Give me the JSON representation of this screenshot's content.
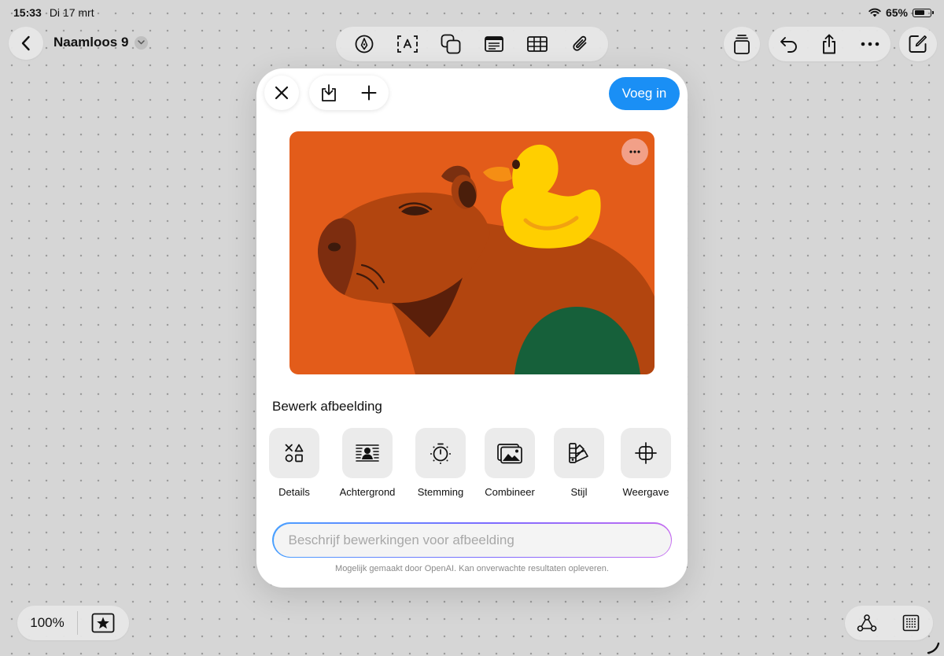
{
  "status_bar": {
    "time": "15:33",
    "date": "Di 17 mrt",
    "battery": "65%",
    "battery_level": 0.65
  },
  "header": {
    "document_title": "Naamloos 9",
    "center_tools": [
      "pen-circle-icon",
      "text-box-icon",
      "shapes-icon",
      "note-card-icon",
      "table-icon",
      "paperclip-icon"
    ],
    "right_tools": [
      "stack-icon",
      "undo-icon",
      "share-icon",
      "more-icon",
      "compose-icon"
    ]
  },
  "modal": {
    "insert_label": "Voeg in",
    "edit_title": "Bewerk afbeelding",
    "edit_options": [
      {
        "label": "Details",
        "icon": "shapes-detail-icon"
      },
      {
        "label": "Achtergrond",
        "icon": "background-person-icon"
      },
      {
        "label": "Stemming",
        "icon": "mood-dial-icon"
      },
      {
        "label": "Combineer",
        "icon": "combine-photos-icon"
      },
      {
        "label": "Stijl",
        "icon": "style-swatch-icon"
      },
      {
        "label": "Weergave",
        "icon": "view-crop-icon"
      }
    ],
    "prompt_placeholder": "Beschrijf bewerkingen voor afbeelding",
    "disclaimer": "Mogelijk gemaakt door OpenAI. Kan onverwachte resultaten opleveren.",
    "colors": {
      "accent": "#1a8ff5",
      "art_background": "#e35c1a",
      "capybara": "#b2450f",
      "duck": "#ffcf00",
      "hill": "#16603a"
    }
  },
  "footer": {
    "zoom": "100%"
  }
}
